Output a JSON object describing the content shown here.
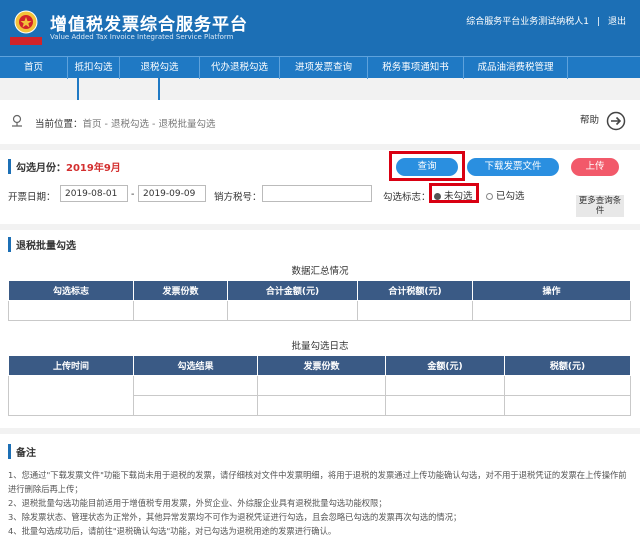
{
  "header": {
    "title_cn": "增值税发票综合服务平台",
    "title_en": "Value Added Tax Invoice Integrated Service Platform",
    "user": "综合服务平台业务测试纳税人1",
    "separator": "|",
    "logout": "退出"
  },
  "nav": {
    "items": [
      {
        "label": "首页"
      },
      {
        "label": "抵扣勾选"
      },
      {
        "label": "退税勾选"
      },
      {
        "label": "代办退税勾选"
      },
      {
        "label": "进项发票查询"
      },
      {
        "label": "税务事项通知书"
      },
      {
        "label": "成品油消费税管理"
      }
    ]
  },
  "breadcrumb": {
    "label": "当前位置：",
    "path": "首页 - 退税勾选 - 退税批量勾选",
    "help": "帮助"
  },
  "query": {
    "title_prefix": "勾选月份：",
    "month": "2019年9月",
    "query_button": "查询",
    "download_button": "下载发票文件",
    "upload_button": "上传",
    "date_label": "开票日期：",
    "date_from": "2019-08-01",
    "date_dash": "-",
    "date_to": "2019-09-09",
    "seller_tax_label": "销方税号：",
    "seller_tax_value": "",
    "flag_label": "勾选标志：",
    "option_unselected": "未勾选",
    "option_selected": "已勾选",
    "more_conditions": "更多查询条件"
  },
  "batch": {
    "title": "退税批量勾选",
    "summary_caption": "数据汇总情况",
    "summary_headers": [
      "勾选标志",
      "发票份数",
      "合计金额(元)",
      "合计税额(元)",
      "操作"
    ],
    "log_caption": "批量勾选日志",
    "log_headers": [
      "上传时间",
      "勾选结果",
      "发票份数",
      "金额(元)",
      "税额(元)"
    ]
  },
  "notes": {
    "title": "备注",
    "items": [
      "1、您通过\"下载发票文件\"功能下载尚未用于退税的发票，请仔细核对文件中发票明细，将用于退税的发票通过上传功能确认勾选，对不用于退税凭证的发票在上传操作前进行删除后再上传；",
      "2、退税批量勾选功能目前适用于增值税专用发票，外贸企业、外综服企业具有退税批量勾选功能权限；",
      "3、除发票状态、管理状态为正常外，其他异常发票均不可作为退税凭证进行勾选，且会忽略已勾选的发票再次勾选的情况；",
      "4、批量勾选成功后，请前往\"退税确认勾选\"功能，对已勾选为退税用途的发票进行确认。"
    ]
  },
  "colors": {
    "header_blue": "#1c6fb5",
    "nav_blue": "#1f79c4",
    "button_blue": "#2a8fe0",
    "upload_pink": "#f2596a",
    "table_header": "#3a5a85",
    "highlight_red": "#d90012",
    "month_red": "#d32f2f"
  }
}
